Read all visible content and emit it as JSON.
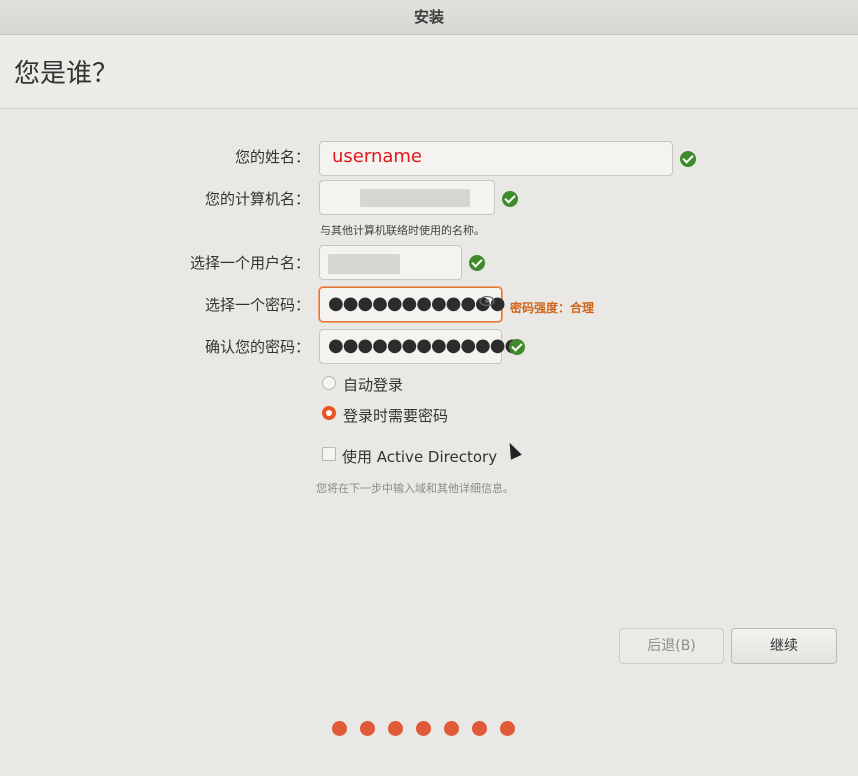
{
  "window": {
    "title": "安装"
  },
  "page": {
    "title": "您是谁？"
  },
  "form": {
    "name_label": "您的姓名：",
    "name_value": "username",
    "computer_label": "您的计算机名：",
    "computer_hint": "与其他计算机联络时使用的名称。",
    "username_label": "选择一个用户名：",
    "password_label": "选择一个密码：",
    "password_dots": "●●●●●●●●●●●●",
    "password_strength": "密码强度：合理",
    "confirm_label": "确认您的密码：",
    "confirm_dots": "●●●●●●●●●●●●●"
  },
  "login": {
    "auto_login": "自动登录",
    "require_password": "登录时需要密码",
    "selected": "require_password"
  },
  "ad": {
    "label": "使用 Active Directory",
    "checked": false,
    "note": "您将在下一步中输入域和其他详细信息。"
  },
  "buttons": {
    "back": "后退(B)",
    "continue": "继续"
  },
  "progress": {
    "steps": 7
  },
  "colors": {
    "accent": "#e95420",
    "check": "#3f8b2b",
    "error_text": "#e0181c"
  }
}
